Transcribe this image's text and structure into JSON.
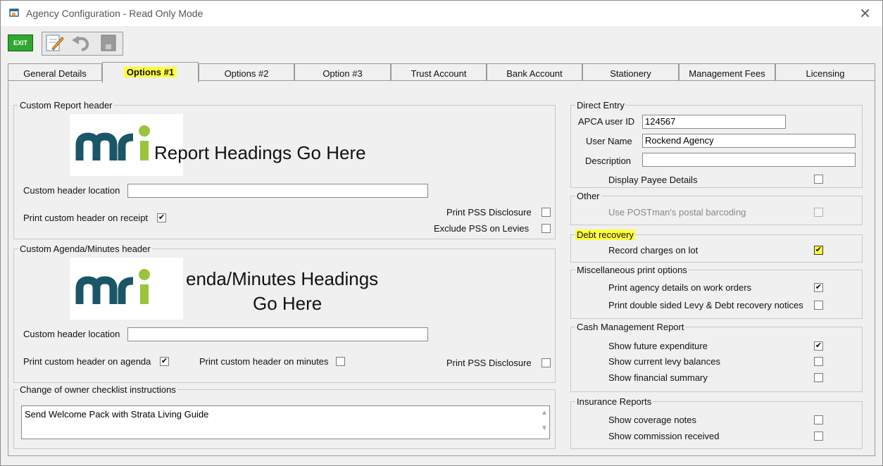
{
  "window": {
    "title": "Agency Configuration - Read Only Mode"
  },
  "toolbar": {
    "exit_label": "EXIT"
  },
  "tabs": [
    "General Details",
    "Options #1",
    "Options #2",
    "Option #3",
    "Trust Account",
    "Bank Account",
    "Stationery",
    "Management Fees",
    "Licensing"
  ],
  "active_tab": "Options #1",
  "report_header": {
    "legend": "Custom Report header",
    "logo_text": "Report Headings Go Here",
    "location_label": "Custom header location",
    "location_value": "",
    "print_receipt_label": "Print custom header on receipt",
    "print_receipt_checked": "✔",
    "pss_disclosure_label": "Print PSS Disclosure",
    "exclude_pss_label": "Exclude PSS on Levies"
  },
  "agenda_header": {
    "legend": "Custom Agenda/Minutes header",
    "logo_text_line1": "enda/Minutes Headings",
    "logo_text_line2": "Go Here",
    "location_label": "Custom header location",
    "location_value": "",
    "print_agenda_label": "Print custom header on agenda",
    "print_agenda_checked": "✔",
    "print_minutes_label": "Print custom header on minutes",
    "pss_disclosure_label": "Print PSS Disclosure"
  },
  "owner_checklist": {
    "legend": "Change of owner checklist instructions",
    "text": "Send Welcome Pack with Strata Living Guide"
  },
  "direct_entry": {
    "legend": "Direct Entry",
    "apca_label": "APCA user ID",
    "apca_value": "124567",
    "username_label": "User Name",
    "username_value": "Rockend Agency",
    "description_label": "Description",
    "description_value": "",
    "display_payee_label": "Display Payee Details"
  },
  "other": {
    "legend": "Other",
    "postman_label": "Use POSTman's postal barcoding"
  },
  "debt_recovery": {
    "legend": "Debt recovery",
    "record_charges_label": "Record charges on lot",
    "record_charges_checked": "✔"
  },
  "misc_print": {
    "legend": "Miscellaneous print options",
    "agency_details_label": "Print agency details on work orders",
    "agency_details_checked": "✔",
    "double_sided_label": "Print double sided Levy & Debt recovery notices"
  },
  "cash_mgmt": {
    "legend": "Cash Management Report",
    "future_exp_label": "Show future expenditure",
    "future_exp_checked": "✔",
    "current_levy_label": "Show current levy balances",
    "financial_summary_label": "Show financial summary"
  },
  "insurance": {
    "legend": "Insurance Reports",
    "coverage_label": "Show coverage notes",
    "commission_label": "Show commission received"
  },
  "colors": {
    "mri_dark": "#1b5668",
    "mri_green": "#9ac43c",
    "highlight": "#ffff3c"
  }
}
